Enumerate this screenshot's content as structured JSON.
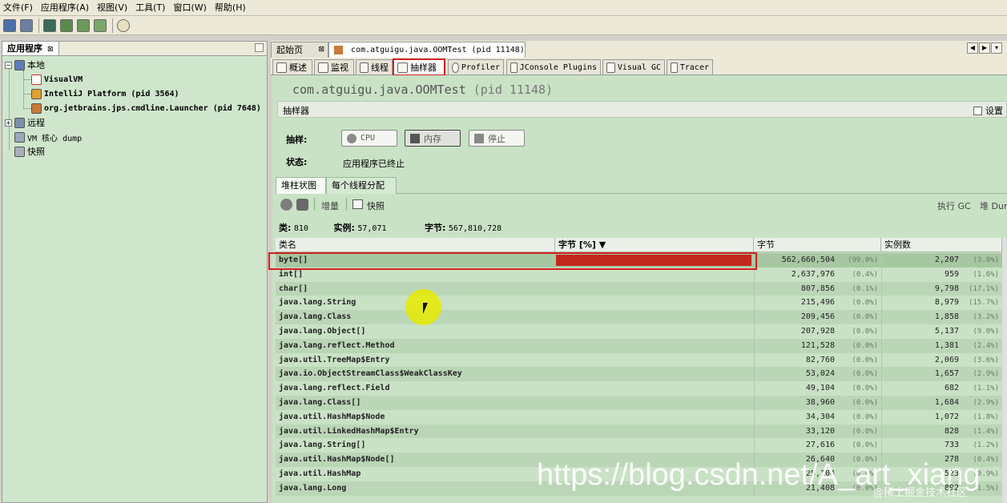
{
  "menu": [
    "文件(F)",
    "应用程序(A)",
    "视图(V)",
    "工具(T)",
    "窗口(W)",
    "帮助(H)"
  ],
  "left_panel": {
    "tab_label": "应用程序",
    "close_glyph": "⊠",
    "tree": {
      "local": "本地",
      "visualvm": "VisualVM",
      "intellij": "IntelliJ Platform (pid 3564)",
      "launcher": "org.jetbrains.jps.cmdline.Launcher (pid 7648)",
      "remote": "远程",
      "core_dump": "VM 核心 dump",
      "snapshot": "快照"
    }
  },
  "doc_tabs": {
    "start": "起始页",
    "app": "com.atguigu.java.OOMTest (pid 11148)"
  },
  "sub_tabs": [
    "概述",
    "监视",
    "线程",
    "抽样器",
    "Profiler",
    "JConsole Plugins",
    "Visual GC",
    "Tracer"
  ],
  "page": {
    "title_app": "com.atguigu.java.OOMTest",
    "title_pid": "(pid 11148)",
    "section_label": "抽样器",
    "settings_label": "设置",
    "sample_label": "抽样:",
    "cpu_button": "CPU",
    "memory_button": "内存",
    "stop_button": "停止",
    "status_label": "状态:",
    "status_value": "应用程序已终止",
    "view_tabs": [
      "堆柱状图",
      "每个线程分配"
    ],
    "delta_label": "增量",
    "snapshot_label": "快照",
    "gc_label": "执行 GC",
    "heapdump_label": "堆 Dump",
    "summary": {
      "classes_label": "类:",
      "classes_value": "810",
      "instances_label": "实例:",
      "instances_value": "57,071",
      "bytes_label": "字节:",
      "bytes_value": "567,810,728"
    }
  },
  "table": {
    "headers": [
      "类名",
      "字节 [%] ▼",
      "字节",
      "实例数"
    ],
    "rows": [
      {
        "name": "byte[]",
        "bytes": "562,660,504",
        "bytes_pct": "(99.0%)",
        "instances": "2,207",
        "inst_pct": "(3.8%)",
        "bar": 0.99
      },
      {
        "name": "int[]",
        "bytes": "2,637,976",
        "bytes_pct": "(0.4%)",
        "instances": "959",
        "inst_pct": "(1.6%)",
        "bar": 0.004
      },
      {
        "name": "char[]",
        "bytes": "807,856",
        "bytes_pct": "(0.1%)",
        "instances": "9,798",
        "inst_pct": "(17.1%)",
        "bar": 0.001
      },
      {
        "name": "java.lang.String",
        "bytes": "215,496",
        "bytes_pct": "(0.0%)",
        "instances": "8,979",
        "inst_pct": "(15.7%)",
        "bar": 0
      },
      {
        "name": "java.lang.Class",
        "bytes": "209,456",
        "bytes_pct": "(0.0%)",
        "instances": "1,858",
        "inst_pct": "(3.2%)",
        "bar": 0
      },
      {
        "name": "java.lang.Object[]",
        "bytes": "207,928",
        "bytes_pct": "(0.0%)",
        "instances": "5,137",
        "inst_pct": "(9.0%)",
        "bar": 0
      },
      {
        "name": "java.lang.reflect.Method",
        "bytes": "121,528",
        "bytes_pct": "(0.0%)",
        "instances": "1,381",
        "inst_pct": "(2.4%)",
        "bar": 0
      },
      {
        "name": "java.util.TreeMap$Entry",
        "bytes": "82,760",
        "bytes_pct": "(0.0%)",
        "instances": "2,069",
        "inst_pct": "(3.6%)",
        "bar": 0
      },
      {
        "name": "java.io.ObjectStreamClass$WeakClassKey",
        "bytes": "53,024",
        "bytes_pct": "(0.0%)",
        "instances": "1,657",
        "inst_pct": "(2.9%)",
        "bar": 0
      },
      {
        "name": "java.lang.reflect.Field",
        "bytes": "49,104",
        "bytes_pct": "(0.0%)",
        "instances": "682",
        "inst_pct": "(1.1%)",
        "bar": 0
      },
      {
        "name": "java.lang.Class[]",
        "bytes": "38,960",
        "bytes_pct": "(0.0%)",
        "instances": "1,684",
        "inst_pct": "(2.9%)",
        "bar": 0
      },
      {
        "name": "java.util.HashMap$Node",
        "bytes": "34,304",
        "bytes_pct": "(0.0%)",
        "instances": "1,072",
        "inst_pct": "(1.8%)",
        "bar": 0
      },
      {
        "name": "java.util.LinkedHashMap$Entry",
        "bytes": "33,120",
        "bytes_pct": "(0.0%)",
        "instances": "828",
        "inst_pct": "(1.4%)",
        "bar": 0
      },
      {
        "name": "java.lang.String[]",
        "bytes": "27,616",
        "bytes_pct": "(0.0%)",
        "instances": "733",
        "inst_pct": "(1.2%)",
        "bar": 0
      },
      {
        "name": "java.util.HashMap$Node[]",
        "bytes": "26,640",
        "bytes_pct": "(0.0%)",
        "instances": "278",
        "inst_pct": "(0.4%)",
        "bar": 0
      },
      {
        "name": "java.util.HashMap",
        "bytes": "25,104",
        "bytes_pct": "(0.0%)",
        "instances": "523",
        "inst_pct": "(0.9%)",
        "bar": 0
      },
      {
        "name": "java.lang.Long",
        "bytes": "21,408",
        "bytes_pct": "(0.0%)",
        "instances": "892",
        "inst_pct": "(1.5%)",
        "bar": 0
      }
    ]
  },
  "watermark": "https://blog.csdn.net/A_art_xiang",
  "watermark_small": "@稀土掘金技术社区",
  "colors": {
    "bar": "#c1281b",
    "highlight": "#d42020",
    "panel_bg": "#c9e2c5"
  }
}
